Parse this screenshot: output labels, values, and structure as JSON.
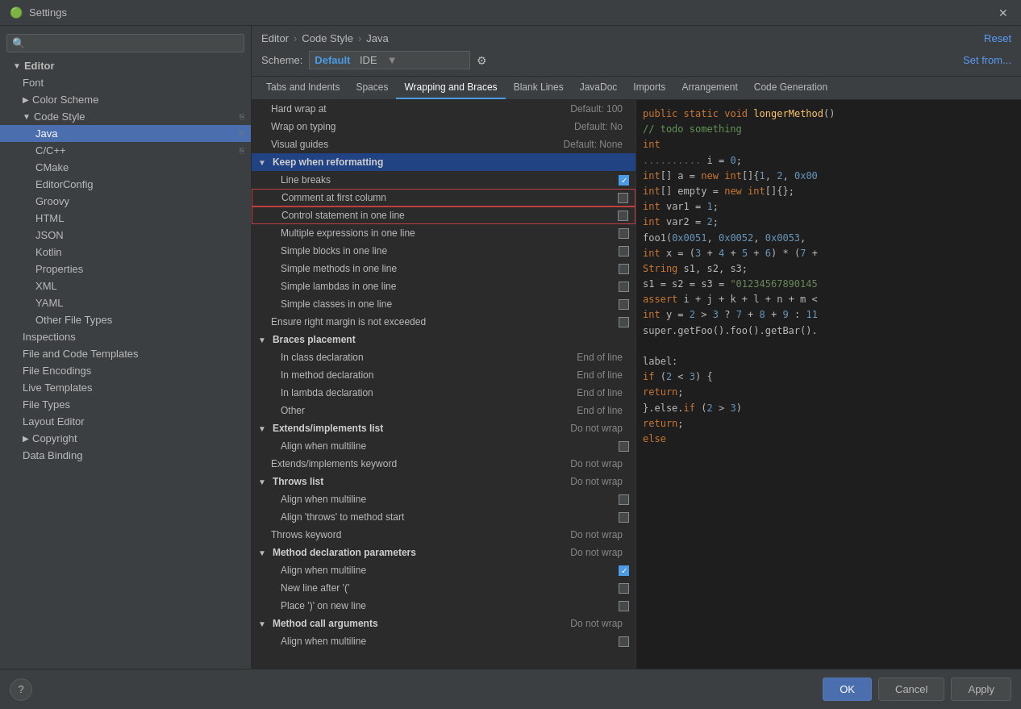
{
  "titlebar": {
    "title": "Settings",
    "icon": "⚙"
  },
  "sidebar": {
    "search_placeholder": "🔍",
    "items": [
      {
        "id": "editor",
        "label": "Editor",
        "level": 1,
        "type": "header",
        "expanded": true
      },
      {
        "id": "font",
        "label": "Font",
        "level": 2,
        "type": "item"
      },
      {
        "id": "color-scheme",
        "label": "Color Scheme",
        "level": 2,
        "type": "item",
        "has_arrow": true
      },
      {
        "id": "code-style",
        "label": "Code Style",
        "level": 2,
        "type": "item",
        "expanded": true,
        "has_arrow": true,
        "has_copy": true
      },
      {
        "id": "java",
        "label": "Java",
        "level": 3,
        "type": "item",
        "selected": true,
        "has_copy": true
      },
      {
        "id": "c-cpp",
        "label": "C/C++",
        "level": 3,
        "type": "item",
        "has_copy": true
      },
      {
        "id": "cmake",
        "label": "CMake",
        "level": 3,
        "type": "item"
      },
      {
        "id": "editorconfig",
        "label": "EditorConfig",
        "level": 3,
        "type": "item"
      },
      {
        "id": "groovy",
        "label": "Groovy",
        "level": 3,
        "type": "item"
      },
      {
        "id": "html",
        "label": "HTML",
        "level": 3,
        "type": "item"
      },
      {
        "id": "json",
        "label": "JSON",
        "level": 3,
        "type": "item"
      },
      {
        "id": "kotlin",
        "label": "Kotlin",
        "level": 3,
        "type": "item"
      },
      {
        "id": "properties",
        "label": "Properties",
        "level": 3,
        "type": "item"
      },
      {
        "id": "xml",
        "label": "XML",
        "level": 3,
        "type": "item"
      },
      {
        "id": "yaml",
        "label": "YAML",
        "level": 3,
        "type": "item"
      },
      {
        "id": "other-file-types",
        "label": "Other File Types",
        "level": 3,
        "type": "item"
      },
      {
        "id": "inspections",
        "label": "Inspections",
        "level": 2,
        "type": "item"
      },
      {
        "id": "file-code-templates",
        "label": "File and Code Templates",
        "level": 2,
        "type": "item"
      },
      {
        "id": "file-encodings",
        "label": "File Encodings",
        "level": 2,
        "type": "item"
      },
      {
        "id": "live-templates",
        "label": "Live Templates",
        "level": 2,
        "type": "item"
      },
      {
        "id": "file-types",
        "label": "File Types",
        "level": 2,
        "type": "item"
      },
      {
        "id": "layout-editor",
        "label": "Layout Editor",
        "level": 2,
        "type": "item"
      },
      {
        "id": "copyright",
        "label": "Copyright",
        "level": 2,
        "type": "item",
        "has_arrow": true
      },
      {
        "id": "data-binding",
        "label": "Data Binding",
        "level": 2,
        "type": "item"
      }
    ]
  },
  "breadcrumb": {
    "parts": [
      "Editor",
      "Code Style",
      "Java"
    ],
    "reset_label": "Reset"
  },
  "scheme": {
    "label": "Scheme:",
    "default_text": "Default",
    "ide_text": "IDE",
    "set_from_label": "Set from..."
  },
  "tabs": [
    {
      "id": "tabs-indents",
      "label": "Tabs and Indents"
    },
    {
      "id": "spaces",
      "label": "Spaces"
    },
    {
      "id": "wrapping-braces",
      "label": "Wrapping and Braces",
      "active": true
    },
    {
      "id": "blank-lines",
      "label": "Blank Lines"
    },
    {
      "id": "javadoc",
      "label": "JavaDoc"
    },
    {
      "id": "imports",
      "label": "Imports"
    },
    {
      "id": "arrangement",
      "label": "Arrangement"
    },
    {
      "id": "code-generation",
      "label": "Code Generation"
    }
  ],
  "settings_rows": [
    {
      "id": "hard-wrap",
      "label": "Hard wrap at",
      "value": "Default: 100",
      "type": "value",
      "indent": 0
    },
    {
      "id": "wrap-typing",
      "label": "Wrap on typing",
      "value": "Default: No",
      "type": "value",
      "indent": 0
    },
    {
      "id": "visual-guides",
      "label": "Visual guides",
      "value": "Default: None",
      "type": "value",
      "indent": 0
    },
    {
      "id": "keep-reformatting",
      "label": "Keep when reformatting",
      "value": "",
      "type": "section",
      "indent": 0,
      "expanded": true,
      "selected": true
    },
    {
      "id": "line-breaks",
      "label": "Line breaks",
      "value": "",
      "type": "checkbox",
      "checked": true,
      "indent": 1
    },
    {
      "id": "comment-first-col",
      "label": "Comment at first column",
      "value": "",
      "type": "checkbox",
      "checked": false,
      "indent": 1,
      "red_border": true
    },
    {
      "id": "control-stmt-one-line",
      "label": "Control statement in one line",
      "value": "",
      "type": "checkbox",
      "checked": false,
      "indent": 1,
      "red_border": true
    },
    {
      "id": "multiple-expr",
      "label": "Multiple expressions in one line",
      "value": "",
      "type": "checkbox",
      "checked": false,
      "indent": 1
    },
    {
      "id": "simple-blocks",
      "label": "Simple blocks in one line",
      "value": "",
      "type": "checkbox",
      "checked": false,
      "indent": 1
    },
    {
      "id": "simple-methods",
      "label": "Simple methods in one line",
      "value": "",
      "type": "checkbox",
      "checked": false,
      "indent": 1
    },
    {
      "id": "simple-lambdas",
      "label": "Simple lambdas in one line",
      "value": "",
      "type": "checkbox",
      "checked": false,
      "indent": 1
    },
    {
      "id": "simple-classes",
      "label": "Simple classes in one line",
      "value": "",
      "type": "checkbox",
      "checked": false,
      "indent": 1
    },
    {
      "id": "ensure-margin",
      "label": "Ensure right margin is not exceeded",
      "value": "",
      "type": "checkbox",
      "checked": false,
      "indent": 0
    },
    {
      "id": "braces-placement",
      "label": "Braces placement",
      "value": "",
      "type": "section",
      "indent": 0,
      "expanded": true
    },
    {
      "id": "in-class-decl",
      "label": "In class declaration",
      "value": "End of line",
      "type": "value",
      "indent": 1
    },
    {
      "id": "in-method-decl",
      "label": "In method declaration",
      "value": "End of line",
      "type": "value",
      "indent": 1
    },
    {
      "id": "in-lambda-decl",
      "label": "In lambda declaration",
      "value": "End of line",
      "type": "value",
      "indent": 1
    },
    {
      "id": "other",
      "label": "Other",
      "value": "End of line",
      "type": "value",
      "indent": 1
    },
    {
      "id": "extends-list",
      "label": "Extends/implements list",
      "value": "Do not wrap",
      "type": "section",
      "indent": 0,
      "expanded": true
    },
    {
      "id": "align-multiline-ext",
      "label": "Align when multiline",
      "value": "",
      "type": "checkbox",
      "checked": false,
      "indent": 1
    },
    {
      "id": "extends-keyword",
      "label": "Extends/implements keyword",
      "value": "Do not wrap",
      "type": "value",
      "indent": 0
    },
    {
      "id": "throws-list",
      "label": "Throws list",
      "value": "Do not wrap",
      "type": "section",
      "indent": 0,
      "expanded": true
    },
    {
      "id": "align-multiline-throws",
      "label": "Align when multiline",
      "value": "",
      "type": "checkbox",
      "checked": false,
      "indent": 1
    },
    {
      "id": "align-throws-method",
      "label": "Align 'throws' to method start",
      "value": "",
      "type": "checkbox",
      "checked": false,
      "indent": 1
    },
    {
      "id": "throws-keyword",
      "label": "Throws keyword",
      "value": "Do not wrap",
      "type": "value",
      "indent": 0
    },
    {
      "id": "method-decl-params",
      "label": "Method declaration parameters",
      "value": "Do not wrap",
      "type": "section",
      "indent": 0,
      "expanded": true
    },
    {
      "id": "align-multiline-method",
      "label": "Align when multiline",
      "value": "",
      "type": "checkbox",
      "checked": true,
      "indent": 1
    },
    {
      "id": "new-line-after-paren",
      "label": "New line after '('",
      "value": "",
      "type": "checkbox",
      "checked": false,
      "indent": 1
    },
    {
      "id": "place-on-new-line",
      "label": "Place ')' on new line",
      "value": "",
      "type": "checkbox",
      "checked": false,
      "indent": 1
    },
    {
      "id": "method-call-args",
      "label": "Method call arguments",
      "value": "Do not wrap",
      "type": "section",
      "indent": 0,
      "expanded": true
    },
    {
      "id": "align-multiline-call",
      "label": "Align when multiline",
      "value": "",
      "type": "checkbox",
      "checked": false,
      "indent": 1
    }
  ],
  "code_preview": [
    {
      "text": "public static void longerMethod()",
      "parts": [
        {
          "t": "kw",
          "v": "public"
        },
        {
          "t": "text",
          "v": " "
        },
        {
          "t": "kw",
          "v": "static"
        },
        {
          "t": "text",
          "v": " "
        },
        {
          "t": "kw",
          "v": "void"
        },
        {
          "t": "text",
          "v": " "
        },
        {
          "t": "fn",
          "v": "longerMethod"
        },
        {
          "t": "text",
          "v": "()"
        }
      ]
    },
    {
      "text": "    // todo something",
      "parts": [
        {
          "t": "text",
          "v": "    "
        },
        {
          "t": "cm",
          "v": "// todo something"
        }
      ]
    },
    {
      "text": "    int",
      "parts": [
        {
          "t": "text",
          "v": "    "
        },
        {
          "t": "kw",
          "v": "int"
        }
      ]
    },
    {
      "text": "        .......... i = 0;",
      "parts": [
        {
          "t": "text",
          "v": "    "
        },
        {
          "t": "dots",
          "v": ".......... "
        },
        {
          "t": "text",
          "v": "i = "
        },
        {
          "t": "num",
          "v": "0"
        },
        {
          "t": "text",
          "v": ";"
        }
      ]
    },
    {
      "text": "    int[] a = new int[]{1, 2, 0x0...",
      "parts": [
        {
          "t": "text",
          "v": "    "
        },
        {
          "t": "kw",
          "v": "int"
        },
        {
          "t": "text",
          "v": "[] a = "
        },
        {
          "t": "kw",
          "v": "new"
        },
        {
          "t": "text",
          "v": " "
        },
        {
          "t": "kw",
          "v": "int"
        },
        {
          "t": "text",
          "v": "[]{"
        },
        {
          "t": "num",
          "v": "1"
        },
        {
          "t": "text",
          "v": ", "
        },
        {
          "t": "num",
          "v": "2"
        },
        {
          "t": "text",
          "v": ", "
        },
        {
          "t": "num",
          "v": "0x00"
        }
      ]
    },
    {
      "text": "    int[] empty = new int[]{};",
      "parts": [
        {
          "t": "text",
          "v": "    "
        },
        {
          "t": "kw",
          "v": "int"
        },
        {
          "t": "text",
          "v": "[] empty = "
        },
        {
          "t": "kw",
          "v": "new"
        },
        {
          "t": "text",
          "v": " "
        },
        {
          "t": "kw",
          "v": "int"
        },
        {
          "t": "text",
          "v": "[]{};"
        }
      ]
    },
    {
      "text": "    int var1 = 1;",
      "parts": [
        {
          "t": "text",
          "v": "    "
        },
        {
          "t": "kw",
          "v": "int"
        },
        {
          "t": "text",
          "v": " var1 = "
        },
        {
          "t": "num",
          "v": "1"
        },
        {
          "t": "text",
          "v": ";"
        }
      ]
    },
    {
      "text": "    int var2 = 2;",
      "parts": [
        {
          "t": "text",
          "v": "    "
        },
        {
          "t": "kw",
          "v": "int"
        },
        {
          "t": "text",
          "v": " var2 = "
        },
        {
          "t": "num",
          "v": "2"
        },
        {
          "t": "text",
          "v": ";"
        }
      ]
    },
    {
      "text": "    foo1(0x0051, 0x0052, 0x0053,...",
      "parts": [
        {
          "t": "text",
          "v": "    foo1("
        },
        {
          "t": "num",
          "v": "0x0051"
        },
        {
          "t": "text",
          "v": ", "
        },
        {
          "t": "num",
          "v": "0x0052"
        },
        {
          "t": "text",
          "v": ", "
        },
        {
          "t": "num",
          "v": "0x0053"
        }
      ]
    },
    {
      "text": "    int x = (3 + 4 + 5 + 6) * (7 +",
      "parts": [
        {
          "t": "text",
          "v": "    "
        },
        {
          "t": "kw",
          "v": "int"
        },
        {
          "t": "text",
          "v": " x = ("
        },
        {
          "t": "num",
          "v": "3"
        },
        {
          "t": "text",
          "v": " + "
        },
        {
          "t": "num",
          "v": "4"
        },
        {
          "t": "text",
          "v": " + "
        },
        {
          "t": "num",
          "v": "5"
        },
        {
          "t": "text",
          "v": " + "
        },
        {
          "t": "num",
          "v": "6"
        },
        {
          "t": "text",
          "v": ") * ("
        },
        {
          "t": "num",
          "v": "7"
        }
      ]
    },
    {
      "text": "    String s1, s2, s3;",
      "parts": [
        {
          "t": "text",
          "v": "    "
        },
        {
          "t": "kw",
          "v": "String"
        },
        {
          "t": "text",
          "v": " s1, s2, s3;"
        }
      ]
    },
    {
      "text": "    s1 = s2 = s3 = \"01234567890145...",
      "parts": [
        {
          "t": "text",
          "v": "    s1 = s2 = s3 = "
        },
        {
          "t": "str",
          "v": "\"01234567890145"
        }
      ]
    },
    {
      "text": "    assert i + j + k + l + n + m <",
      "parts": [
        {
          "t": "text",
          "v": "    "
        },
        {
          "t": "kw",
          "v": "assert"
        },
        {
          "t": "text",
          "v": " i + j + k + l + n + m <"
        }
      ]
    },
    {
      "text": "    int y = 2 > 3 ? 7 + 8 + 9 : 11",
      "parts": [
        {
          "t": "text",
          "v": "    "
        },
        {
          "t": "kw",
          "v": "int"
        },
        {
          "t": "text",
          "v": " y = "
        },
        {
          "t": "num",
          "v": "2"
        },
        {
          "t": "text",
          "v": " > "
        },
        {
          "t": "num",
          "v": "3"
        },
        {
          "t": "text",
          "v": " ? "
        },
        {
          "t": "num",
          "v": "7"
        },
        {
          "t": "text",
          "v": " + "
        },
        {
          "t": "num",
          "v": "8"
        },
        {
          "t": "text",
          "v": " + "
        },
        {
          "t": "num",
          "v": "9"
        },
        {
          "t": "text",
          "v": " : "
        },
        {
          "t": "num",
          "v": "11"
        }
      ]
    },
    {
      "text": "    super.getFoo().foo().getBar().",
      "parts": [
        {
          "t": "text",
          "v": "    super.getFoo().foo().getBar()."
        }
      ]
    },
    {
      "text": "",
      "parts": []
    },
    {
      "text": "label:",
      "parts": [
        {
          "t": "text",
          "v": "label:"
        }
      ]
    },
    {
      "text": "    if (2 < 3) {",
      "parts": [
        {
          "t": "text",
          "v": "    "
        },
        {
          "t": "kw",
          "v": "if"
        },
        {
          "t": "text",
          "v": " ("
        },
        {
          "t": "num",
          "v": "2"
        },
        {
          "t": "text",
          "v": " < "
        },
        {
          "t": "num",
          "v": "3"
        },
        {
          "t": "text",
          "v": ") {"
        }
      ]
    },
    {
      "text": "        return;",
      "parts": [
        {
          "t": "text",
          "v": "        "
        },
        {
          "t": "kw",
          "v": "return"
        },
        {
          "t": "text",
          "v": ";"
        }
      ]
    },
    {
      "text": "    }.else.if (2 > 3)",
      "parts": [
        {
          "t": "text",
          "v": "    }.else."
        },
        {
          "t": "kw",
          "v": "if"
        },
        {
          "t": "text",
          "v": " ("
        },
        {
          "t": "num",
          "v": "2"
        },
        {
          "t": "text",
          "v": " > "
        },
        {
          "t": "num",
          "v": "3"
        },
        {
          "t": "text",
          "v": ")"
        }
      ]
    },
    {
      "text": "        return;",
      "parts": [
        {
          "t": "text",
          "v": "        "
        },
        {
          "t": "kw",
          "v": "return"
        },
        {
          "t": "text",
          "v": ";"
        }
      ]
    },
    {
      "text": "    else",
      "parts": [
        {
          "t": "text",
          "v": "    "
        },
        {
          "t": "kw",
          "v": "else"
        }
      ]
    }
  ],
  "buttons": {
    "ok": "OK",
    "cancel": "Cancel",
    "apply": "Apply",
    "help": "?"
  }
}
